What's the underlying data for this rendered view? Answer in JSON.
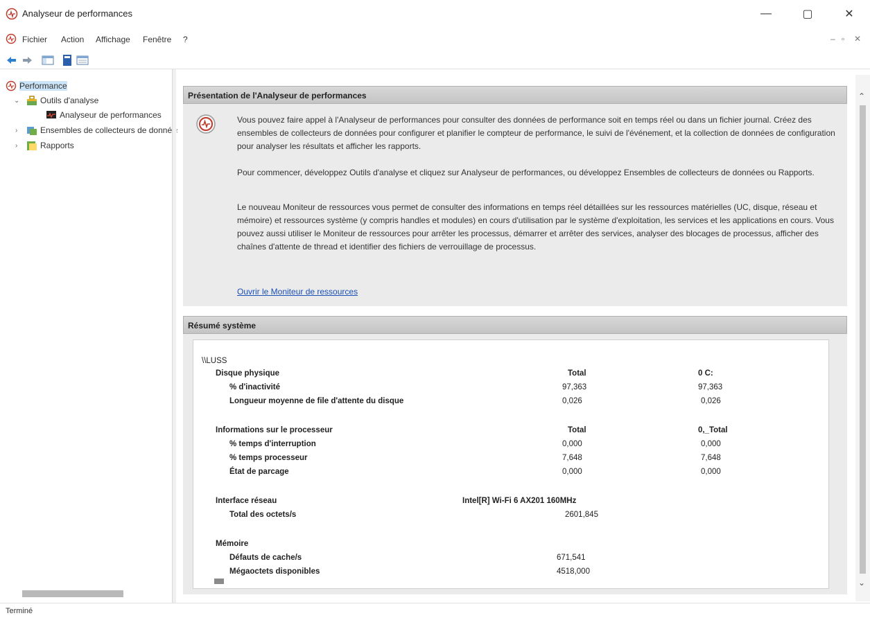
{
  "window": {
    "title": "Analyseur de performances",
    "minimize": "—",
    "maximize": "▢",
    "close": "✕"
  },
  "menu": {
    "items": [
      "Fichier",
      "Action",
      "Affichage",
      "Fenêtre",
      "?"
    ],
    "mdi": [
      "–",
      "▫",
      "✕"
    ]
  },
  "toolbar": {
    "icons": [
      "back-icon",
      "forward-icon",
      "show-hide-console-tree-icon",
      "help-icon",
      "properties-icon"
    ]
  },
  "tree": {
    "root": "Performance",
    "items": [
      {
        "label": "Outils d'analyse",
        "expander": "⌄"
      },
      {
        "label": "Analyseur de performances",
        "expander": ""
      },
      {
        "label": "Ensembles de collecteurs de données",
        "expander": "›"
      },
      {
        "label": "Rapports",
        "expander": "›"
      }
    ]
  },
  "overview": {
    "header": "Présentation de l'Analyseur de performances",
    "para1": "Vous pouvez faire appel à l'Analyseur de performances pour consulter des données de performance soit en temps réel ou dans un fichier journal. Créez des ensembles de collecteurs de données pour configurer et planifier le compteur de performance, le suivi de l'événement, et la collection de données de configuration pour analyser les résultats et afficher les rapports.",
    "para2": "Pour commencer, développez Outils d'analyse et cliquez sur Analyseur de performances, ou développez Ensembles de collecteurs de données ou Rapports.",
    "para3": "Le nouveau Moniteur de ressources vous permet de consulter des informations en temps réel détaillées sur les ressources matérielles (UC, disque, réseau et mémoire) et ressources système (y compris handles et modules) en cours d'utilisation par le système d'exploitation, les services et les applications en cours. Vous pouvez aussi utiliser le Moniteur de ressources pour arrêter les processus, démarrer et arrêter des services, analyser des blocages de processus, afficher des chaînes d'attente de thread et identifier des fichiers de verrouillage de processus.",
    "link": "Ouvrir le Moniteur de ressources"
  },
  "summary": {
    "header": "Résumé système",
    "host": "\\\\LUSS",
    "disk": {
      "title": "Disque physique",
      "col1": "Total",
      "col2": "0 C:",
      "rows": [
        {
          "label": "% d'inactivité",
          "v1": "97,363",
          "v2": "97,363"
        },
        {
          "label": "Longueur moyenne de file d'attente du disque",
          "v1": "0,026",
          "v2": "0,026"
        }
      ]
    },
    "cpu": {
      "title": "Informations sur le processeur",
      "col1": "Total",
      "col2": "0,_Total",
      "rows": [
        {
          "label": "% temps d'interruption",
          "v1": "0,000",
          "v2": "0,000"
        },
        {
          "label": "% temps processeur",
          "v1": "7,648",
          "v2": "7,648"
        },
        {
          "label": "État de parcage",
          "v1": "0,000",
          "v2": "0,000"
        }
      ]
    },
    "net": {
      "title": "Interface réseau",
      "col1": "Intel[R] Wi-Fi 6 AX201 160MHz",
      "rows": [
        {
          "label": "Total des octets/s",
          "v1": "2601,845"
        }
      ]
    },
    "mem": {
      "title": "Mémoire",
      "rows": [
        {
          "label": "Défauts de cache/s",
          "v1": "671,541"
        },
        {
          "label": "Mégaoctets disponibles",
          "v1": "4518,000"
        }
      ]
    }
  },
  "status": "Terminé",
  "colors": {
    "header_bg": "#c8c8c8",
    "panel_bg": "#ebebeb",
    "link": "#1a4fb5",
    "selection": "#cce4f7"
  }
}
